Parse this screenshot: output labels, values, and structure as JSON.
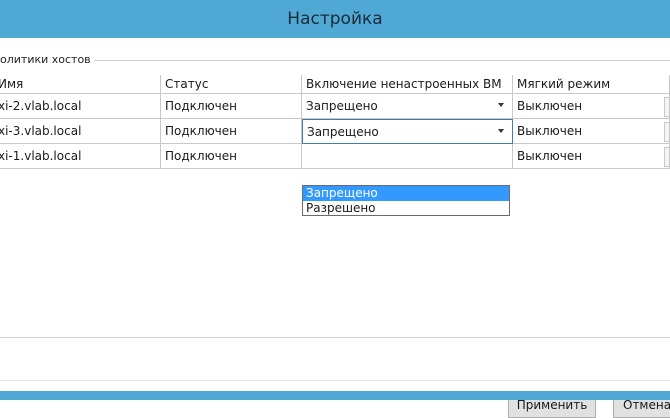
{
  "window": {
    "title": "Настройка"
  },
  "group": {
    "label": "олитики хостов"
  },
  "table": {
    "columns": [
      "Имя",
      "Статус",
      "Включение ненастроенных ВМ",
      "Мягкий режим"
    ],
    "rows": [
      {
        "name": "xi-2.vlab.local",
        "status": "Подключен",
        "unconfigured_vm": "Запрещено",
        "soft_mode": "Выключен"
      },
      {
        "name": "xi-3.vlab.local",
        "status": "Подключен",
        "unconfigured_vm": "Запрещено",
        "soft_mode": "Выключен"
      },
      {
        "name": "xi-1.vlab.local",
        "status": "Подключен",
        "unconfigured_vm": "",
        "soft_mode": "Выключен"
      }
    ]
  },
  "dropdown": {
    "options": [
      "Запрещено",
      "Разрешено"
    ],
    "selected": "Запрещено"
  },
  "buttons": {
    "apply": "Применить",
    "cancel": "Отмена"
  },
  "colors": {
    "titlebar": "#4fa9d4",
    "selection": "#3399ff"
  }
}
